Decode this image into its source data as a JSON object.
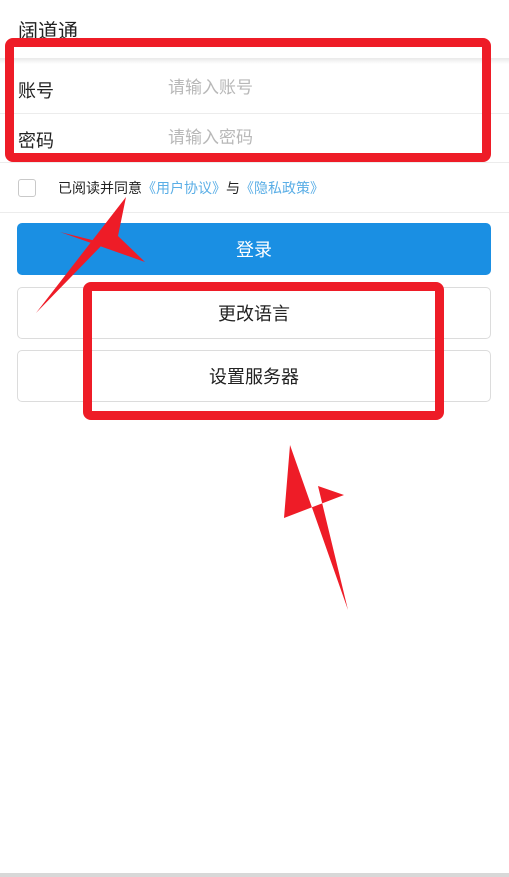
{
  "header": {
    "title": "阔道通"
  },
  "form": {
    "account": {
      "label": "账号",
      "placeholder": "请输入账号"
    },
    "password": {
      "label": "密码",
      "placeholder": "请输入密码"
    }
  },
  "agreement": {
    "prefix": "已阅读并同意",
    "user_agreement": "《用户协议》",
    "connector": "与",
    "privacy_policy": "《隐私政策》"
  },
  "buttons": {
    "login": "登录",
    "change_language": "更改语言",
    "set_server": "设置服务器"
  },
  "colors": {
    "primary": "#1a8fe3",
    "link": "#5aaee6",
    "annotation": "#ee1c27"
  }
}
